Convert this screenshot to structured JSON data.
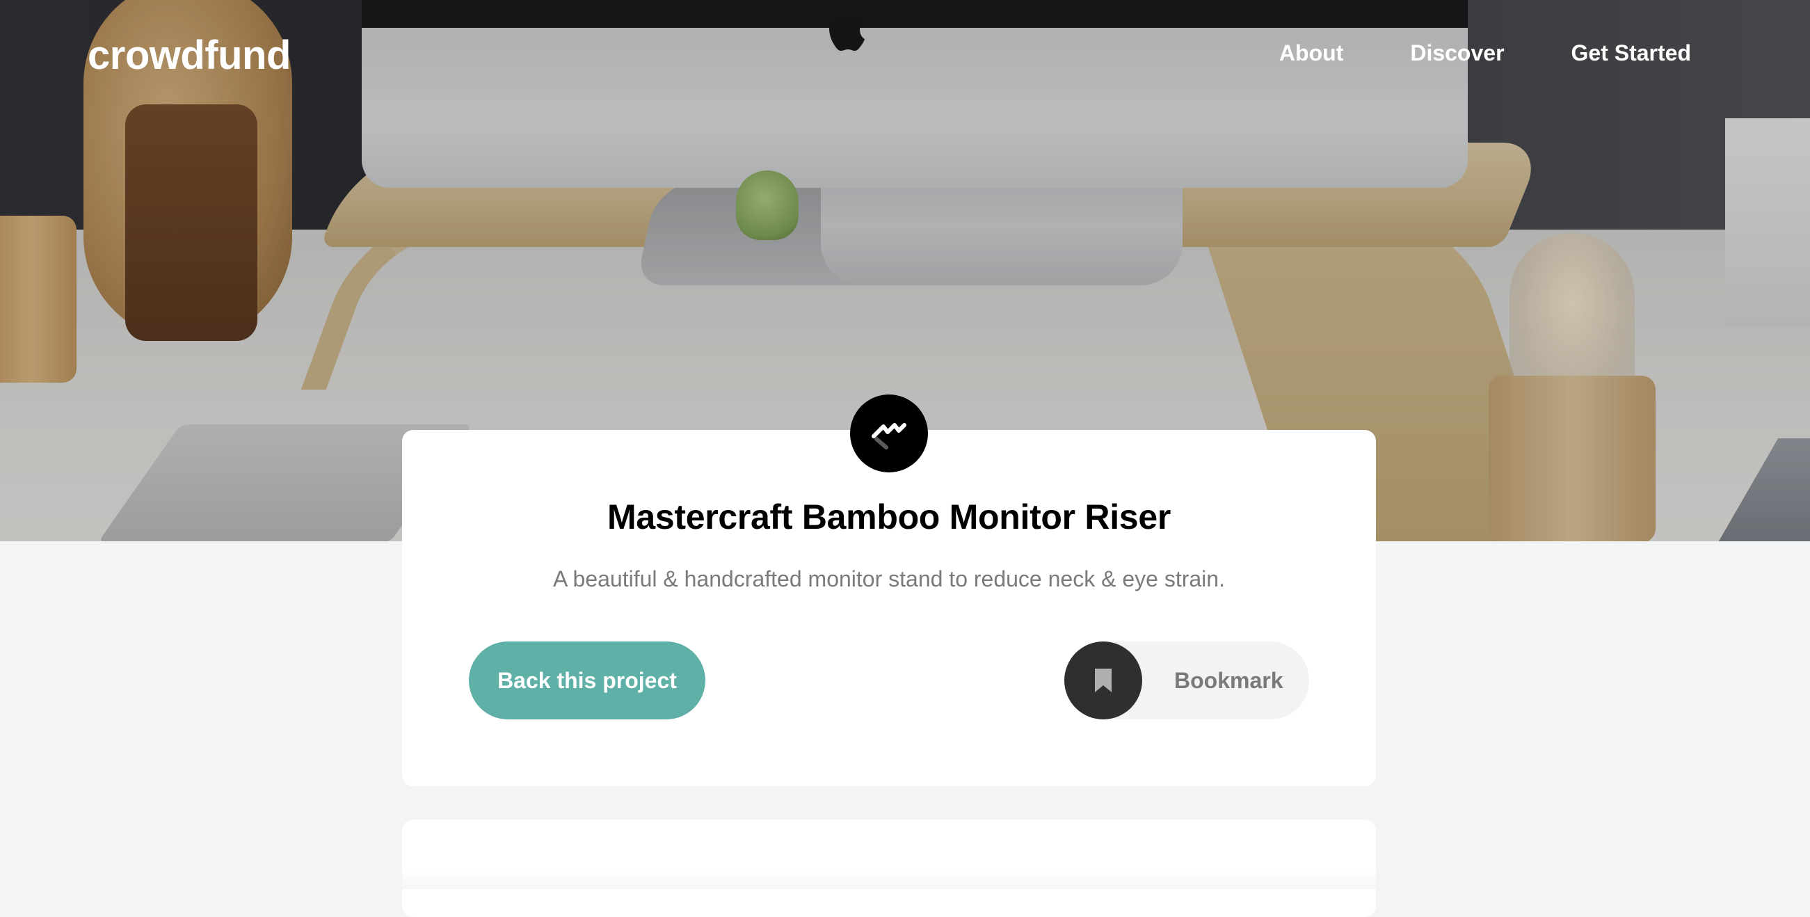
{
  "header": {
    "brand": "crowdfund",
    "nav": [
      {
        "label": "About"
      },
      {
        "label": "Discover"
      },
      {
        "label": "Get Started"
      }
    ]
  },
  "hero": {
    "image": "desk-setup-photo"
  },
  "project": {
    "logo_icon": "mastercraft-logo-icon",
    "title": "Mastercraft Bamboo Monitor Riser",
    "description": "A beautiful & handcrafted monitor stand to reduce neck & eye strain.",
    "back_button_label": "Back this project",
    "bookmark_label": "Bookmark",
    "bookmark_icon": "bookmark-icon"
  },
  "colors": {
    "accent": "#5fb0a7",
    "page_bg": "#f3f4f5",
    "card_bg": "#ffffff",
    "text_dark": "#000000",
    "text_muted": "#7a7a7a",
    "bookmark_circle": "#2f2f2f"
  }
}
